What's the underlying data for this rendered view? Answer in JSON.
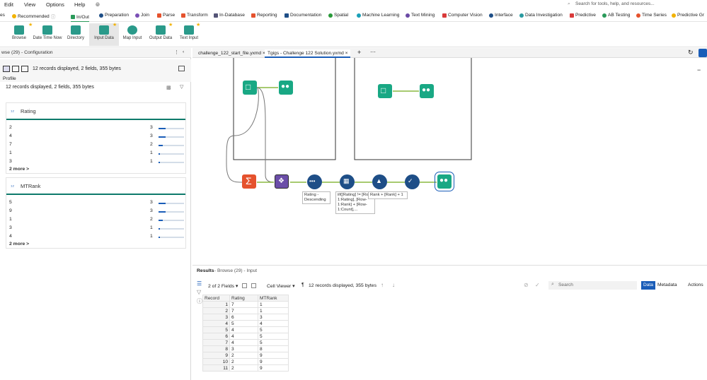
{
  "menubar": {
    "items": [
      "Edit",
      "View",
      "Options",
      "Help"
    ],
    "search_placeholder": "Search for tools, help, and resources..."
  },
  "categories": [
    {
      "label": "es",
      "color": "#888888"
    },
    {
      "label": "Recommended",
      "color": "#f2b200"
    },
    {
      "label": "In/Out",
      "color": "#2a9a5a"
    },
    {
      "label": "Preparation",
      "color": "#1e4e87"
    },
    {
      "label": "Join",
      "color": "#7a4fb5"
    },
    {
      "label": "Parse",
      "color": "#e5522d"
    },
    {
      "label": "Transform",
      "color": "#e5522d"
    },
    {
      "label": "In-Database",
      "color": "#555577"
    },
    {
      "label": "Reporting",
      "color": "#e5522d"
    },
    {
      "label": "Documentation",
      "color": "#1e4e87"
    },
    {
      "label": "Spatial",
      "color": "#2a9a3a"
    },
    {
      "label": "Machine Learning",
      "color": "#1aa0b8"
    },
    {
      "label": "Text Mining",
      "color": "#6a4aa5"
    },
    {
      "label": "Computer Vision",
      "color": "#d93a3a"
    },
    {
      "label": "Interface",
      "color": "#1e4e87"
    },
    {
      "label": "Data Investigation",
      "color": "#2a9aa0"
    },
    {
      "label": "Predictive",
      "color": "#d93a3a"
    },
    {
      "label": "AB Testing",
      "color": "#2a9a5a"
    },
    {
      "label": "Time Series",
      "color": "#e5522d"
    },
    {
      "label": "Predictive Gr",
      "color": "#f2b200"
    }
  ],
  "tools": [
    {
      "label": "Browse",
      "icon": "binoculars-icon"
    },
    {
      "label": "Date Time Now",
      "icon": "calendar-icon"
    },
    {
      "label": "Directory",
      "icon": "folder-icon"
    },
    {
      "label": "Input Data",
      "icon": "book-icon"
    },
    {
      "label": "Map Input",
      "icon": "globe-icon"
    },
    {
      "label": "Output Data",
      "icon": "output-icon"
    },
    {
      "label": "Text Input",
      "icon": "text-input-icon"
    }
  ],
  "left_panel": {
    "header": "wse (29) - Configuration",
    "summary_top": "12 records displayed, 2 fields, 355 bytes",
    "profile_tab": "Profile",
    "summary": "12 records displayed, 2 fields, 355 bytes",
    "fields": [
      {
        "name": "Rating",
        "rows": [
          {
            "value": "2",
            "count": "3",
            "pct": 0.28
          },
          {
            "value": "4",
            "count": "3",
            "pct": 0.28
          },
          {
            "value": "7",
            "count": "2",
            "pct": 0.18
          },
          {
            "value": "1",
            "count": "1",
            "pct": 0.05
          },
          {
            "value": "3",
            "count": "1",
            "pct": 0.05
          }
        ],
        "more": "2 more >"
      },
      {
        "name": "MTRank",
        "rows": [
          {
            "value": "5",
            "count": "3",
            "pct": 0.28
          },
          {
            "value": "9",
            "count": "3",
            "pct": 0.28
          },
          {
            "value": "1",
            "count": "2",
            "pct": 0.18
          },
          {
            "value": "3",
            "count": "1",
            "pct": 0.05
          },
          {
            "value": "4",
            "count": "1",
            "pct": 0.05
          }
        ],
        "more": "2 more >"
      }
    ]
  },
  "doc_tabs": [
    {
      "label": "challenge_122_start_file.yxmd",
      "active": false
    },
    {
      "label": "Tgigs - Challenge 122 Solution.yxmd",
      "active": true
    }
  ],
  "annotations": {
    "sort": "Rating - Descending",
    "multirow1": "iif([Rating] != [Row-1:Rating], [Row-1:Rank] + [Row-1:Count],...",
    "multirow2": "Rank + [Rank] + 1"
  },
  "results": {
    "title": "Results",
    "breadcrumb": "- Browse (29) - Input",
    "fields_selector": "2 of 2 Fields",
    "cell_viewer": "Cell Viewer",
    "summary": "12 records displayed, 355 bytes",
    "search_placeholder": "Search",
    "data_btn": "Data",
    "metadata_btn": "Metadata",
    "actions_btn": "Actions",
    "columns": [
      "Record",
      "Rating",
      "MTRank"
    ],
    "rows": [
      [
        "1",
        "7",
        "1"
      ],
      [
        "2",
        "7",
        "1"
      ],
      [
        "3",
        "6",
        "3"
      ],
      [
        "4",
        "5",
        "4"
      ],
      [
        "5",
        "4",
        "5"
      ],
      [
        "6",
        "4",
        "5"
      ],
      [
        "7",
        "4",
        "5"
      ],
      [
        "8",
        "3",
        "8"
      ],
      [
        "9",
        "2",
        "9"
      ],
      [
        "10",
        "2",
        "9"
      ],
      [
        "11",
        "2",
        "9"
      ]
    ]
  }
}
